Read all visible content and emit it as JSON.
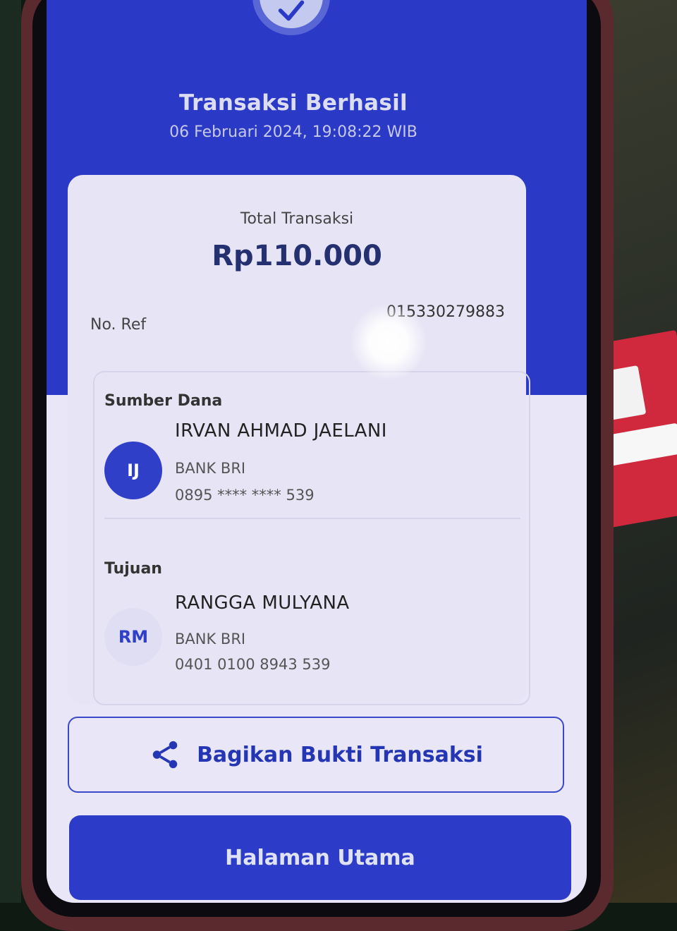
{
  "status": {
    "title": "Transaksi Berhasil",
    "datetime": "06 Februari 2024, 19:08:22 WIB",
    "icon": "check-icon"
  },
  "summary": {
    "total_label": "Total Transaksi",
    "total_amount": "Rp110.000",
    "ref_label": "No. Ref",
    "ref_value": "015330279883"
  },
  "source": {
    "section_label": "Sumber Dana",
    "initials": "IJ",
    "name": "IRVAN AHMAD JAELANI",
    "bank": "BANK BRI",
    "account": "0895 **** **** 539"
  },
  "destination": {
    "section_label": "Tujuan",
    "initials": "RM",
    "name": "RANGGA MULYANA",
    "bank": "BANK BRI",
    "account": "0401 0100 8943 539"
  },
  "actions": {
    "share_label": "Bagikan Bukti Transaksi",
    "share_icon": "share-icon",
    "home_label": "Halaman Utama"
  },
  "colors": {
    "primary_blue": "#2a39c6",
    "accent_text": "#24306f"
  }
}
